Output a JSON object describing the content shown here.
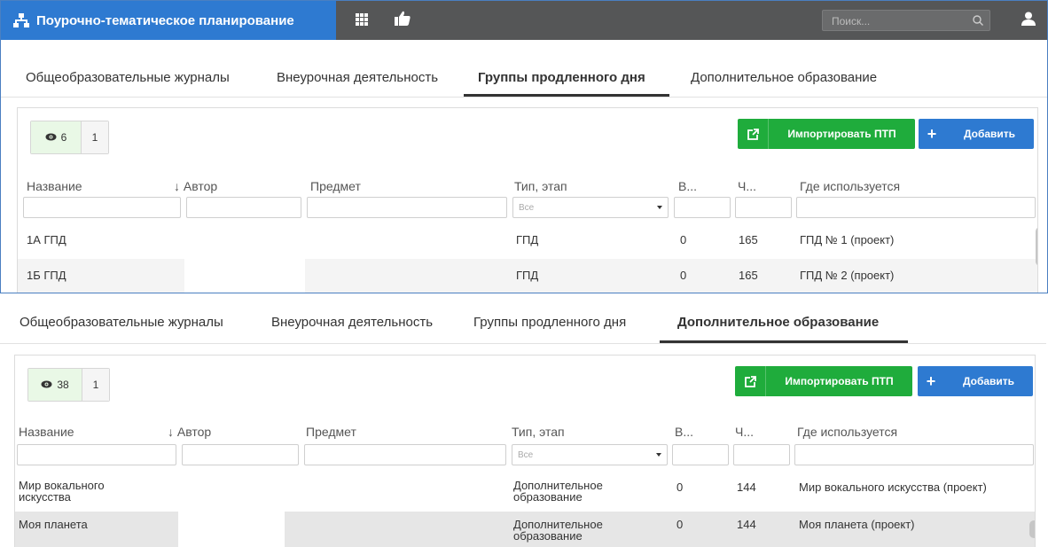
{
  "app": {
    "title": "Поурочно-тематическое планирование"
  },
  "search": {
    "placeholder": "Поиск..."
  },
  "icons": {
    "brand": "sitemap-icon",
    "apps": "grid-icon",
    "like": "thumbs-up-icon",
    "search": "search-icon",
    "user": "user-icon",
    "eye": "eye-icon",
    "import": "external-link-icon",
    "add": "plus-icon"
  },
  "colors": {
    "brand": "#2e7ad1",
    "topbar": "#555657",
    "success": "#1fac3c",
    "counter_bg": "#e9f8e6"
  },
  "panel1": {
    "tabs": [
      {
        "label": "Общеобразовательные журналы"
      },
      {
        "label": "Внеурочная деятельность"
      },
      {
        "label": "Группы продленного дня",
        "active": true
      },
      {
        "label": "Дополнительное образование"
      }
    ],
    "counter": {
      "count": "6",
      "page": "1"
    },
    "import_label": "Импортировать ПТП",
    "add_label": "Добавить",
    "columns": [
      "Название",
      "↓ Автор",
      "Предмет",
      "Тип, этап",
      "В...",
      "Ч...",
      "Где используется"
    ],
    "type_filter": "Все",
    "rows": [
      {
        "name": "1А ГПД",
        "author": "",
        "subject": "",
        "type": "ГПД",
        "v": "0",
        "ch": "165",
        "where": "ГПД № 1 (проект)"
      },
      {
        "name": "1Б ГПД",
        "author": "",
        "subject": "",
        "type": "ГПД",
        "v": "0",
        "ch": "165",
        "where": "ГПД № 2 (проект)"
      }
    ]
  },
  "panel2": {
    "tabs": [
      {
        "label": "Общеобразовательные журналы"
      },
      {
        "label": "Внеурочная деятельность"
      },
      {
        "label": "Группы продленного дня"
      },
      {
        "label": "Дополнительное образование",
        "active": true
      }
    ],
    "counter": {
      "count": "38",
      "page": "1"
    },
    "import_label": "Импортировать ПТП",
    "add_label": "Добавить",
    "columns": [
      "Название",
      "↓ Автор",
      "Предмет",
      "Тип, этап",
      "В...",
      "Ч...",
      "Где используется"
    ],
    "type_filter": "Все",
    "rows": [
      {
        "name": "Мир вокального искусства",
        "author": "",
        "subject": "",
        "type": "Дополнительное образование",
        "v": "0",
        "ch": "144",
        "where": "Мир вокального искусства (проект)"
      },
      {
        "name": "Моя планета",
        "author": "",
        "subject": "",
        "type": "Дополнительное образование",
        "v": "0",
        "ch": "144",
        "where": "Моя планета (проект)"
      }
    ]
  }
}
